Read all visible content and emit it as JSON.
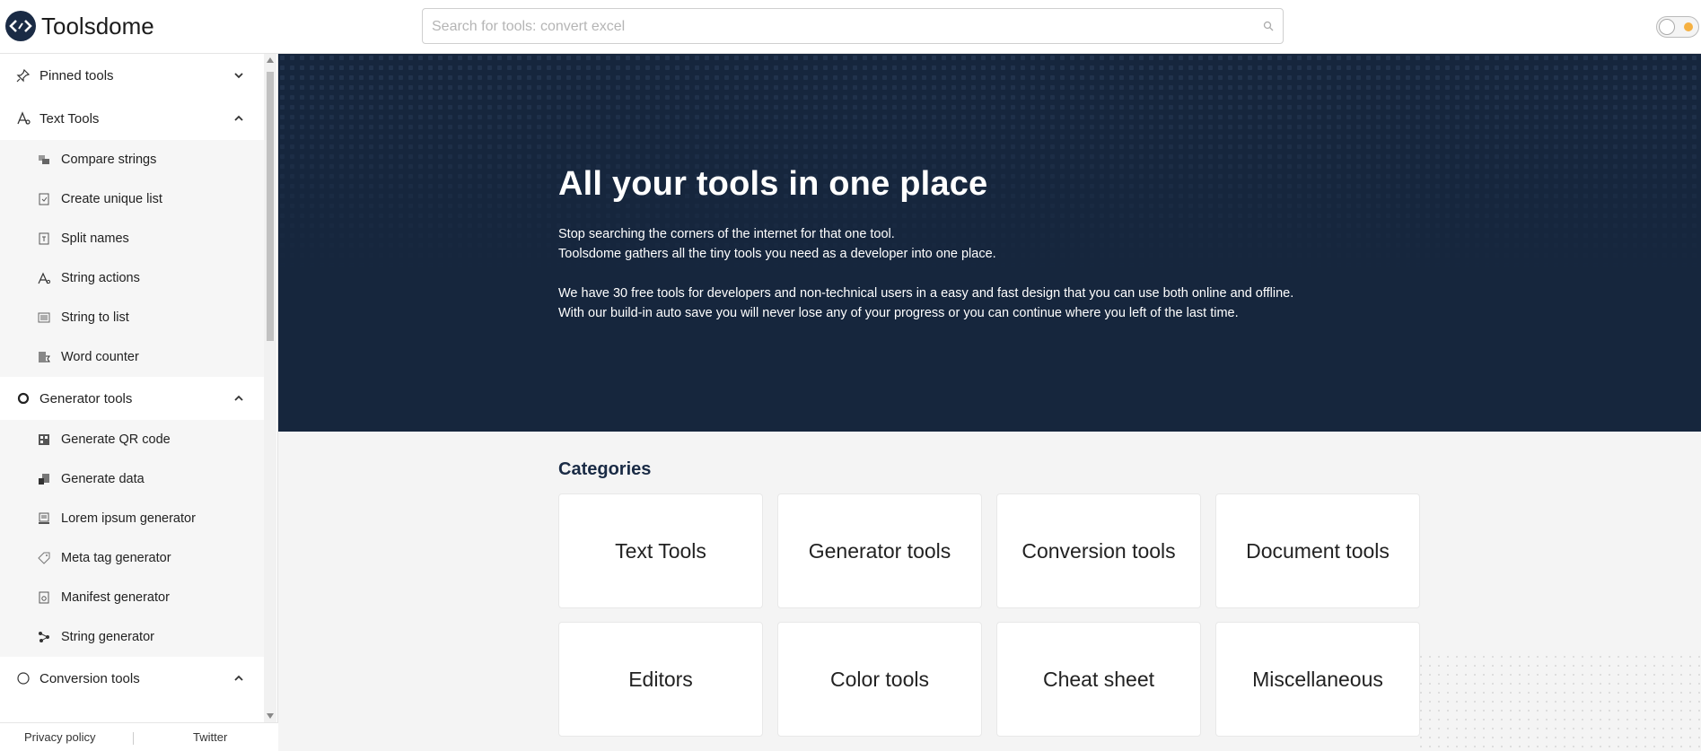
{
  "header": {
    "brand": "Toolsdome",
    "search_placeholder": "Search for tools: convert excel"
  },
  "sidebar": {
    "categories": [
      {
        "label": "Pinned tools",
        "icon": "pin-icon",
        "expanded": false,
        "items": []
      },
      {
        "label": "Text Tools",
        "icon": "text-icon",
        "expanded": true,
        "items": [
          {
            "label": "Compare strings",
            "icon": "compare-icon"
          },
          {
            "label": "Create unique list",
            "icon": "unique-list-icon"
          },
          {
            "label": "Split names",
            "icon": "split-icon"
          },
          {
            "label": "String actions",
            "icon": "string-actions-icon"
          },
          {
            "label": "String to list",
            "icon": "list-icon"
          },
          {
            "label": "Word counter",
            "icon": "counter-icon"
          }
        ]
      },
      {
        "label": "Generator tools",
        "icon": "gear-icon",
        "expanded": true,
        "items": [
          {
            "label": "Generate QR code",
            "icon": "qr-icon"
          },
          {
            "label": "Generate data",
            "icon": "data-icon"
          },
          {
            "label": "Lorem ipsum generator",
            "icon": "lorem-icon"
          },
          {
            "label": "Meta tag generator",
            "icon": "tag-icon"
          },
          {
            "label": "Manifest generator",
            "icon": "manifest-icon"
          },
          {
            "label": "String generator",
            "icon": "molecule-icon"
          }
        ]
      },
      {
        "label": "Conversion tools",
        "icon": "circle-icon",
        "expanded": true,
        "items": []
      }
    ],
    "footer": {
      "privacy": "Privacy policy",
      "twitter": "Twitter"
    }
  },
  "hero": {
    "title": "All your tools in one place",
    "line1": "Stop searching the corners of the internet for that one tool.",
    "line2": "Toolsdome gathers all the tiny tools you need as a developer into one place.",
    "line3": "We have 30 free tools for developers and non-technical users in a easy and fast design that you can use both online and offline.",
    "line4": "With our build-in auto save you will never lose any of your progress or you can continue where you left of the last time."
  },
  "categories_section": {
    "title": "Categories",
    "cards": [
      "Text Tools",
      "Generator tools",
      "Conversion tools",
      "Document tools",
      "Editors",
      "Color tools",
      "Cheat sheet",
      "Miscellaneous"
    ]
  },
  "colors": {
    "hero_bg": "#16263d",
    "accent": "#1a2b45",
    "main_bg": "#f4f4f4"
  }
}
